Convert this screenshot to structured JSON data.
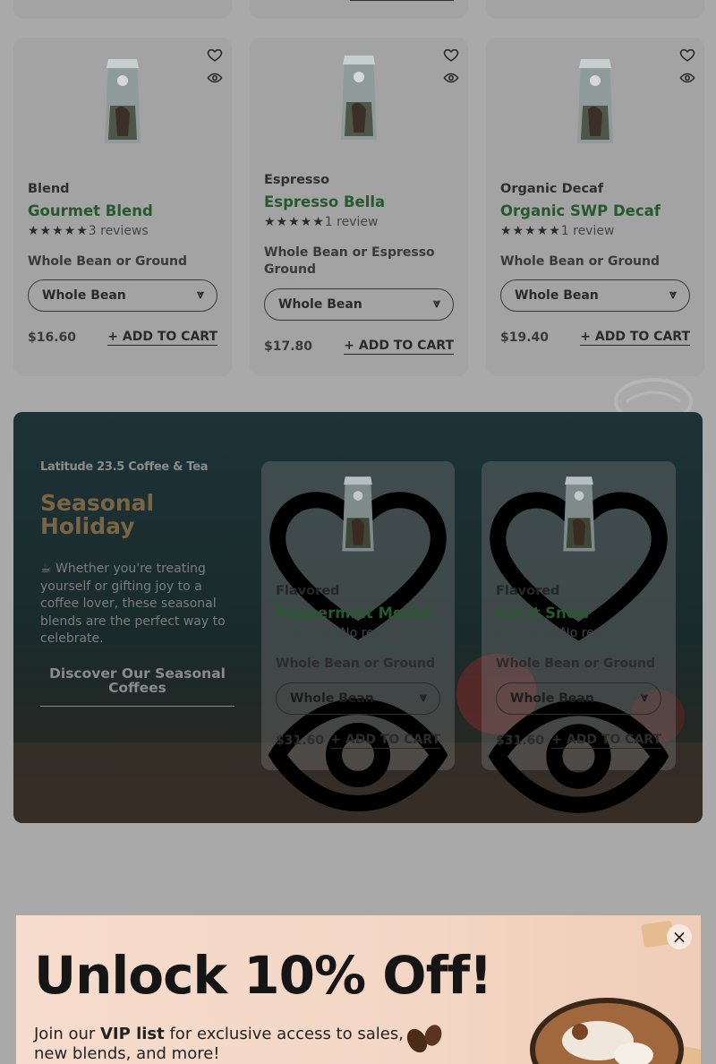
{
  "top_partial": {
    "link_underline": ""
  },
  "products": [
    {
      "category": "Blend",
      "name": "Gourmet Blend",
      "stars": "★★★★★",
      "rating": 5,
      "reviews": "3 reviews",
      "grind": "Whole Bean or Ground",
      "select": "Whole Bean",
      "price": "$16.60",
      "add_label": "+ ADD TO CART"
    },
    {
      "category": "Espresso",
      "name": "Espresso Bella",
      "stars": "★★★★★",
      "rating": 5,
      "reviews": "1 review",
      "grind": "Whole Bean or Espresso Ground",
      "select": "Whole Bean",
      "price": "$17.80",
      "add_label": "+ ADD TO CART"
    },
    {
      "category": "Organic Decaf",
      "name": "Organic SWP Decaf",
      "stars": "★★★★★",
      "rating": 5,
      "reviews": "1 review",
      "grind": "Whole Bean or Ground",
      "select": "Whole Bean",
      "price": "$19.40",
      "add_label": "+ ADD TO CART"
    }
  ],
  "seasonal": {
    "brand": "Latitude 23.5 Coffee & Tea",
    "title": "Seasonal Holiday",
    "description": "☕ Whether you're treating yourself or gifting joy to a coffee lover, these seasonal blends are the perfect way to celebrate.",
    "cta": "Discover Our Seasonal Coffees",
    "products": [
      {
        "category": "Flavored",
        "name": "Peppermint Mocha",
        "stars": "☆☆☆☆☆",
        "rating": 0,
        "reviews": "No reviews",
        "grind": "Whole Bean or Ground",
        "select": "Whole Bean",
        "price": "$31.60",
        "add_label": "+ ADD TO CART"
      },
      {
        "category": "Flavored",
        "name": "Let It Snow",
        "stars": "☆☆☆☆☆",
        "rating": 0,
        "reviews": "No reviews",
        "grind": "Whole Bean or Ground",
        "select": "Whole Bean",
        "price": "$31.60",
        "add_label": "+ ADD TO CART"
      }
    ]
  },
  "popup": {
    "headline": "Unlock 10% Off!",
    "text_before": "Join our ",
    "text_bold": "VIP list",
    "text_after": " for exclusive access to sales, new blends, and more!",
    "close_icon": "×"
  },
  "icons": {
    "wishlist": "heart-icon",
    "quickview": "eye-icon",
    "select_chevron": "double-chevron-down-icon",
    "close": "close-icon"
  },
  "colors": {
    "product_name": "#27592f",
    "seasonal_title": "#7a6442",
    "overlay_background": "#a9a9a9"
  }
}
